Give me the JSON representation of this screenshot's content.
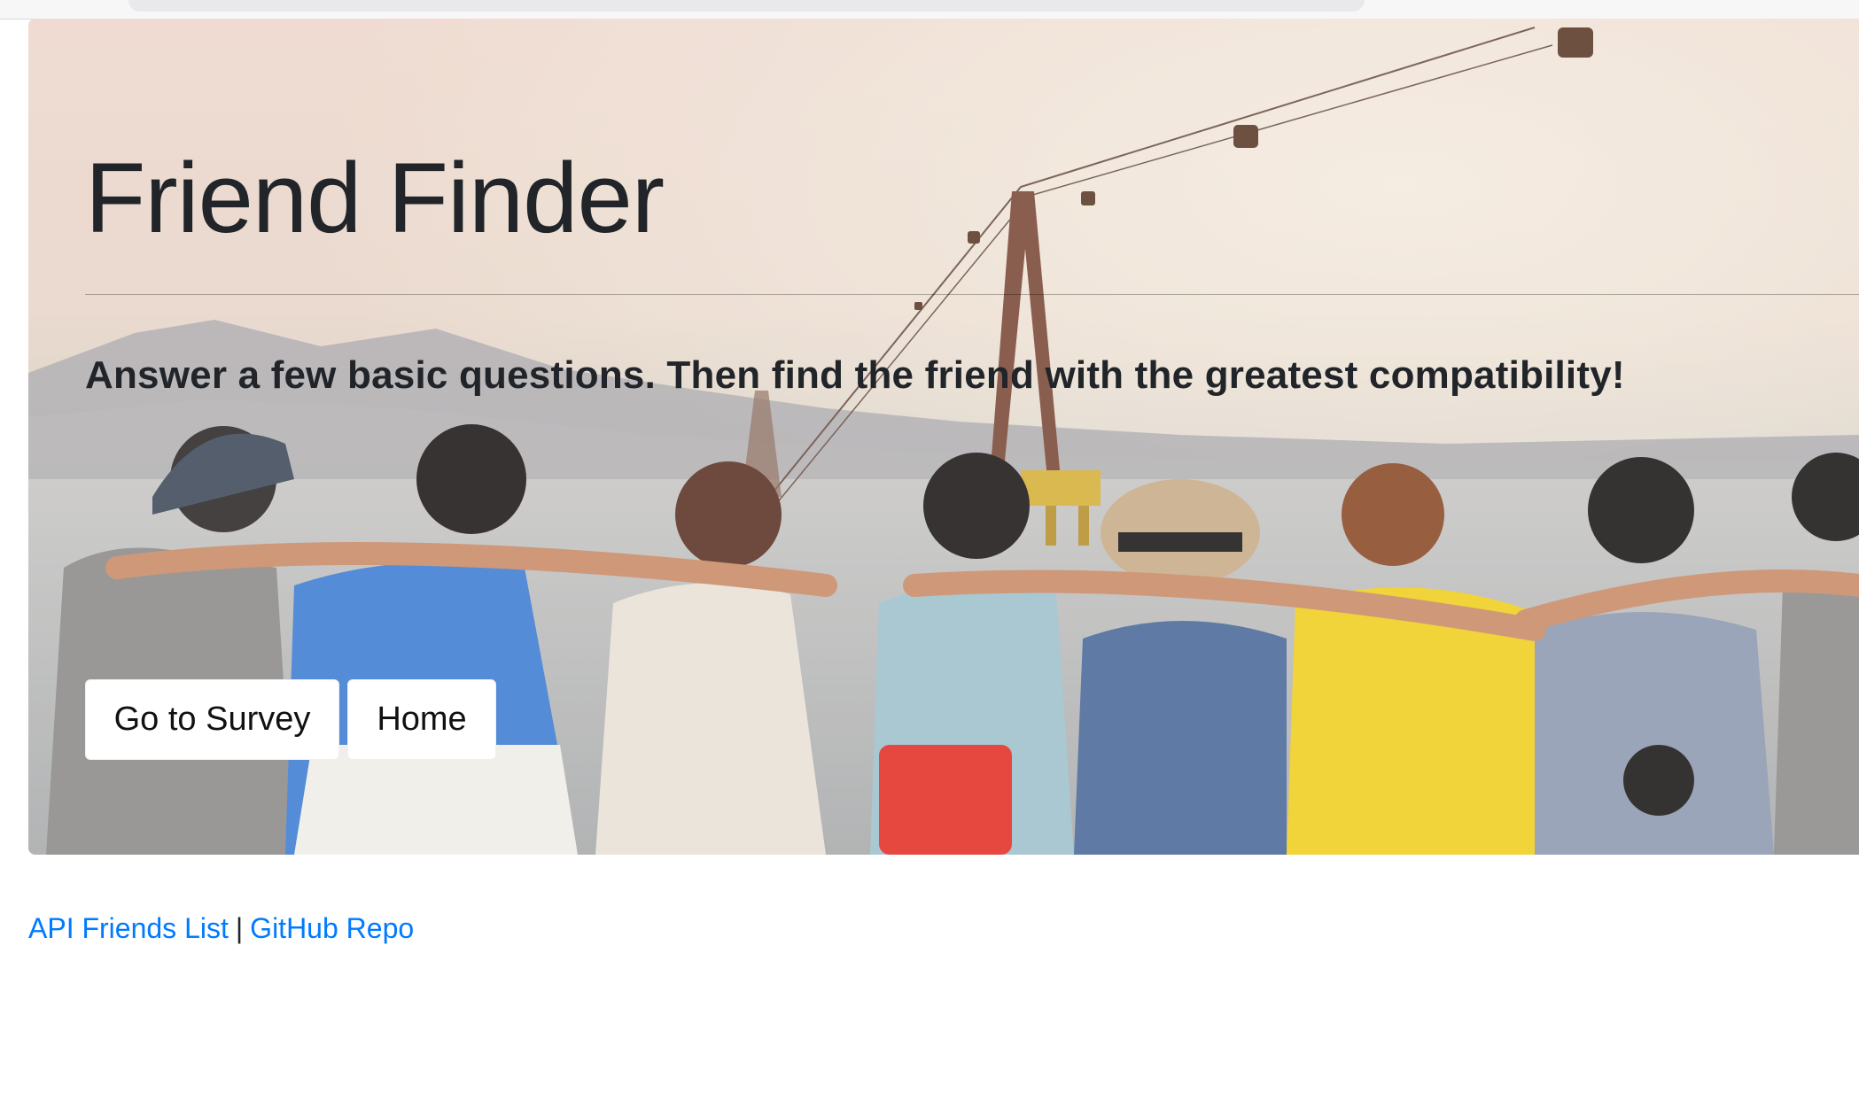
{
  "jumbotron": {
    "title": "Friend Finder",
    "lead": "Answer a few basic questions. Then find the friend with the greatest compatibility!",
    "buttons": {
      "survey_label": "Go to Survey",
      "home_label": "Home"
    }
  },
  "footer": {
    "api_link": "API Friends List",
    "separator": "|",
    "github_link": "GitHub Repo"
  },
  "colors": {
    "link": "#007bff",
    "text": "#212529",
    "button_bg": "#ffffff"
  }
}
